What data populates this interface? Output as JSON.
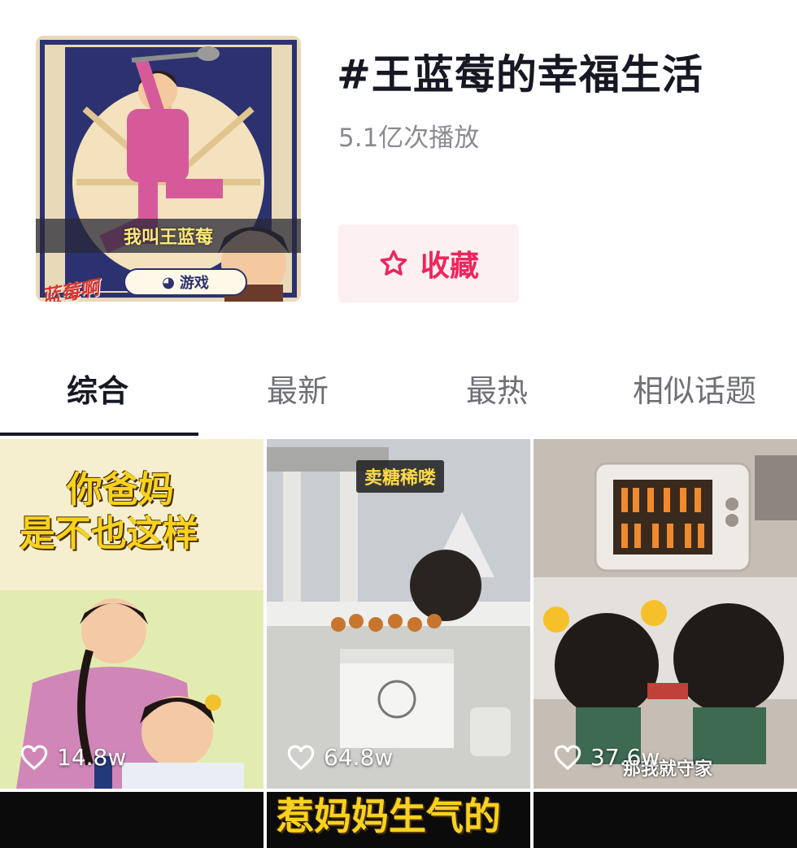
{
  "topic": {
    "title": "#王蓝莓的幸福生活",
    "play_count": "5.1亿次播放",
    "collect_label": "收藏",
    "collect_icon": "star-outline-icon",
    "accent_color": "#f0245d",
    "cover": {
      "caption": "我叫王蓝莓",
      "game_tag": "游戏",
      "game_icon": "pacman-icon",
      "corner_text": "蓝莓啊"
    }
  },
  "tabs": [
    {
      "label": "综合",
      "active": true
    },
    {
      "label": "最新",
      "active": false
    },
    {
      "label": "最热",
      "active": false
    },
    {
      "label": "相似话题",
      "active": false
    }
  ],
  "videos": [
    {
      "overlay_line1": "你爸妈",
      "overlay_line2": "是不也这样",
      "likes": "14.8w",
      "like_icon": "heart-outline-icon"
    },
    {
      "tag": "卖糖稀喽",
      "likes": "64.8w",
      "like_icon": "heart-outline-icon"
    },
    {
      "likes": "37.6w",
      "caption": "那我就守家",
      "like_icon": "heart-outline-icon"
    }
  ],
  "next_row": {
    "caption": "惹妈妈生气的"
  }
}
